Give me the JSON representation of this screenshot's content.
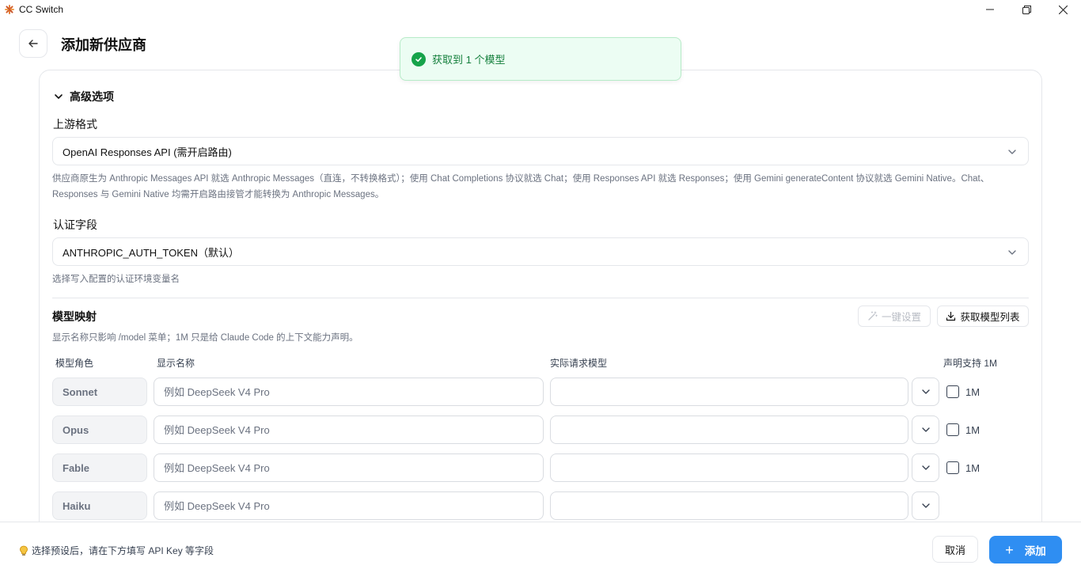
{
  "window": {
    "title": "CC Switch"
  },
  "header": {
    "title": "添加新供应商"
  },
  "toast": {
    "message": "获取到 1 个模型",
    "color": "#15803d"
  },
  "advanced": {
    "section_label": "高级选项",
    "upstream_format": {
      "label": "上游格式",
      "value": "OpenAI Responses API (需开启路由)",
      "help_line1": "供应商原生为 Anthropic Messages API 就选 Anthropic Messages（直连，不转换格式）；使用 Chat Completions 协议就选 Chat；使用 Responses API 就选 Responses；使用 Gemini generateContent 协议就选 Gemini Native。Chat、",
      "help_line2": "Responses 与 Gemini Native 均需开启路由接管才能转换为 Anthropic Messages。"
    },
    "auth_field": {
      "label": "认证字段",
      "value": "ANTHROPIC_AUTH_TOKEN（默认）",
      "help": "选择写入配置的认证环境变量名"
    }
  },
  "model_mapping": {
    "title": "模型映射",
    "description": "显示名称只影响 /model 菜单；1M 只是给 Claude Code 的上下文能力声明。",
    "one_click_label": "一键设置",
    "fetch_label": "获取模型列表",
    "columns": {
      "role": "模型角色",
      "display_name": "显示名称",
      "actual_model": "实际请求模型",
      "declare_1m": "声明支持 1M"
    },
    "rows": [
      {
        "role": "Sonnet",
        "placeholder": "例如 DeepSeek V4 Pro",
        "model": "",
        "has_1m": true,
        "checkbox_label": "1M",
        "checked": false
      },
      {
        "role": "Opus",
        "placeholder": "例如 DeepSeek V4 Pro",
        "model": "",
        "has_1m": true,
        "checkbox_label": "1M",
        "checked": false
      },
      {
        "role": "Fable",
        "placeholder": "例如 DeepSeek V4 Pro",
        "model": "",
        "has_1m": true,
        "checkbox_label": "1M",
        "checked": false
      },
      {
        "role": "Haiku",
        "placeholder": "例如 DeepSeek V4 Pro",
        "model": "",
        "has_1m": false
      }
    ]
  },
  "footer": {
    "hint": "选择预设后，请在下方填写 API Key 等字段",
    "cancel_label": "取消",
    "add_label": "添加",
    "accent_color": "#2f8ef2"
  }
}
